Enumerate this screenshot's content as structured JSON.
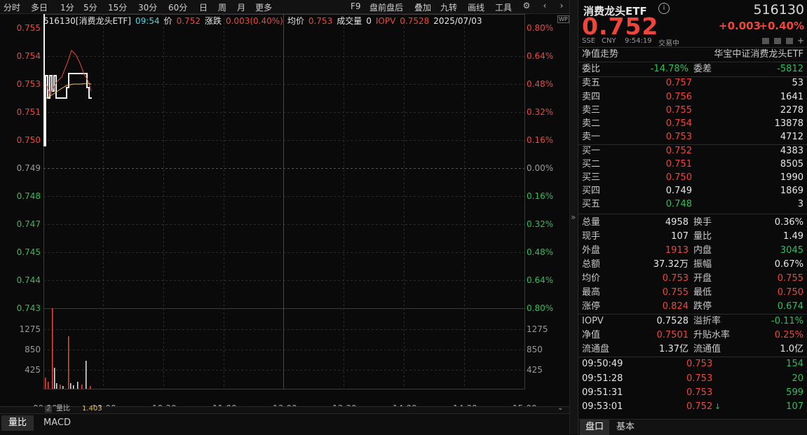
{
  "toolbar": {
    "left_items": [
      "分时",
      "多日",
      "1分",
      "5分",
      "15分",
      "30分",
      "60分",
      "日",
      "周",
      "月",
      "更多"
    ],
    "right_items": [
      "F9",
      "盘前盘后",
      "叠加",
      "九转",
      "画线",
      "工具"
    ]
  },
  "chart": {
    "info": {
      "code_name": "516130[消费龙头ETF]",
      "time": "09:54",
      "price_label": "价",
      "price": "0.752",
      "change_label": "涨跌",
      "change": "0.003(0.40%)",
      "avg_label": "均价",
      "avg": "0.753",
      "vol_label": "成交量",
      "vol": "0",
      "iopv_label": "IOPV",
      "iopv": "0.7528",
      "date": "2025/07/03"
    },
    "price_axis": [
      "0.755",
      "0.754",
      "0.753",
      "0.751",
      "0.750",
      "0.749",
      "0.748",
      "0.747",
      "0.745",
      "0.744",
      "0.743"
    ],
    "pct_axis": [
      "0.80%",
      "0.64%",
      "0.48%",
      "0.32%",
      "0.16%",
      "0.00%",
      "0.16%",
      "0.32%",
      "0.48%",
      "0.64%",
      "0.80%"
    ],
    "vol_axis": [
      "1275",
      "850",
      "425"
    ],
    "time_axis": [
      "09:30",
      "10:00",
      "10:30",
      "11:00",
      "13:00",
      "13:30",
      "14:00",
      "14:30",
      "15:00"
    ],
    "sub_label": "量比",
    "sub_value": "1.403",
    "sub_index": "2"
  },
  "bottom_tabs": [
    "量比",
    "MACD"
  ],
  "panel": {
    "title": "消费龙头ETF",
    "code": "516130",
    "price": "0.752",
    "change": "+0.003",
    "change_pct": "+0.40%",
    "exchange": "SSE",
    "currency": "CNY",
    "time": "9:54:19",
    "status": "交易中",
    "nav_trend": "净值走势",
    "index_name": "华宝中证消费龙头ETF",
    "weibi_label": "委比",
    "weibi": "-14.78%",
    "weicha_label": "委差",
    "weicha": "-5812",
    "sells": [
      {
        "label": "卖五",
        "price": "0.757",
        "vol": "53"
      },
      {
        "label": "卖四",
        "price": "0.756",
        "vol": "1641"
      },
      {
        "label": "卖三",
        "price": "0.755",
        "vol": "2278"
      },
      {
        "label": "卖二",
        "price": "0.754",
        "vol": "13878"
      },
      {
        "label": "卖一",
        "price": "0.753",
        "vol": "4712"
      }
    ],
    "buys": [
      {
        "label": "买一",
        "price": "0.752",
        "vol": "4383"
      },
      {
        "label": "买二",
        "price": "0.751",
        "vol": "8505"
      },
      {
        "label": "买三",
        "price": "0.750",
        "vol": "1990"
      },
      {
        "label": "买四",
        "price": "0.749",
        "vol": "1869"
      },
      {
        "label": "买五",
        "price": "0.748",
        "vol": "3"
      }
    ],
    "stats": [
      {
        "l1": "总量",
        "v1": "4958",
        "l2": "换手",
        "v2": "0.36%"
      },
      {
        "l1": "现手",
        "v1": "107",
        "l2": "量比",
        "v2": "1.49"
      },
      {
        "l1": "外盘",
        "v1": "1913",
        "l2": "内盘",
        "v2": "3045"
      },
      {
        "l1": "总额",
        "v1": "37.32万",
        "l2": "振幅",
        "v2": "0.67%"
      },
      {
        "l1": "均价",
        "v1": "0.753",
        "l2": "开盘",
        "v2": "0.755"
      },
      {
        "l1": "最高",
        "v1": "0.755",
        "l2": "最低",
        "v2": "0.750"
      },
      {
        "l1": "涨停",
        "v1": "0.824",
        "l2": "跌停",
        "v2": "0.674"
      }
    ],
    "etf": [
      {
        "l1": "IOPV",
        "v1": "0.7528",
        "l2": "溢折率",
        "v2": "-0.11%"
      },
      {
        "l1": "净值",
        "v1": "0.7501",
        "l2": "升贴水率",
        "v2": "0.25%"
      },
      {
        "l1": "流通盘",
        "v1": "1.37亿",
        "l2": "流通值",
        "v2": "1.0亿"
      }
    ],
    "ticks": [
      {
        "time": "09:50:49",
        "price": "0.753",
        "vol": "154"
      },
      {
        "time": "09:51:28",
        "price": "0.753",
        "vol": "20"
      },
      {
        "time": "09:51:31",
        "price": "0.753",
        "vol": "599"
      },
      {
        "time": "09:53:01",
        "price": "0.752",
        "vol": "107"
      }
    ],
    "tabs": [
      "盘口",
      "基本"
    ]
  }
}
